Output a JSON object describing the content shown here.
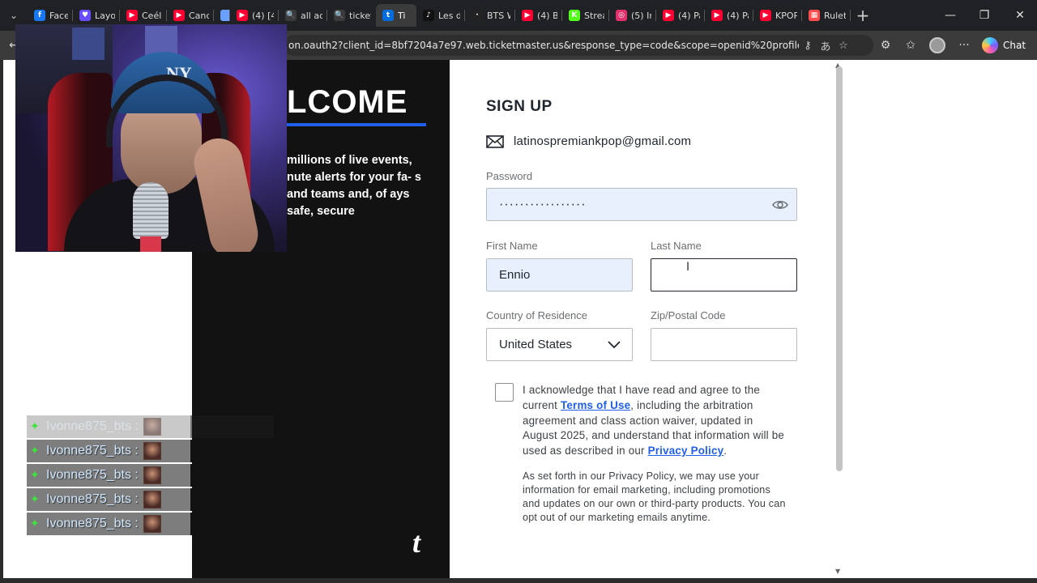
{
  "browser": {
    "tabs": [
      {
        "label": "Faceb",
        "fav_color": "#1877f2",
        "fav_glyph": "f"
      },
      {
        "label": "Layou",
        "fav_color": "#6a4cff",
        "fav_glyph": "♥"
      },
      {
        "label": "Ceéle",
        "fav_color": "#ff0033",
        "fav_glyph": "▶"
      },
      {
        "label": "Canci",
        "fav_color": "#ff0033",
        "fav_glyph": "▶"
      },
      {
        "label": "",
        "fav_color": "#6aa0ff",
        "fav_glyph": ""
      },
      {
        "label": "(4) [4",
        "fav_color": "#ff0033",
        "fav_glyph": "▶"
      },
      {
        "label": "all acc",
        "fav_color": "#3b3b3b",
        "fav_glyph": "🔍"
      },
      {
        "label": "ticket",
        "fav_color": "#3b3b3b",
        "fav_glyph": "🔍"
      },
      {
        "label": "Ti",
        "fav_color": "#026cdf",
        "fav_glyph": "t"
      },
      {
        "label": "Les di",
        "fav_color": "#111111",
        "fav_glyph": "♪"
      },
      {
        "label": "BTS W",
        "fav_color": "#222222",
        "fav_glyph": "·"
      },
      {
        "label": "(4) Bu",
        "fav_color": "#ff0033",
        "fav_glyph": "▶"
      },
      {
        "label": "Strean",
        "fav_color": "#53fc18",
        "fav_glyph": "K"
      },
      {
        "label": "(5) Ins",
        "fav_color": "#e1306c",
        "fav_glyph": "◎"
      },
      {
        "label": "(4) Pa",
        "fav_color": "#ff0033",
        "fav_glyph": "▶"
      },
      {
        "label": "(4) Pa",
        "fav_color": "#ff0033",
        "fav_glyph": "▶"
      },
      {
        "label": "KPOP",
        "fav_color": "#ff0033",
        "fav_glyph": "▶"
      },
      {
        "label": "Rulet",
        "fav_color": "#ff4d4d",
        "fav_glyph": "▦"
      }
    ],
    "active_tab_index": 8,
    "url": "on.oauth2?client_id=8bf7204a7e97.web.ticketmaster.us&response_type=code&scope=openid%20profile%...",
    "chat_label": "Chat"
  },
  "brand_panel": {
    "title": "LCOME",
    "text": "millions of live events, nute alerts for your fa- s and teams and, of ays safe, secure",
    "logo": "t",
    "accent_color": "#1f5ee8"
  },
  "form": {
    "title": "SIGN UP",
    "email": "latinospremiankpop@gmail.com",
    "password_label": "Password",
    "password_value": "·················",
    "first_name_label": "First Name",
    "first_name_value": "Ennio",
    "last_name_label": "Last Name",
    "last_name_value": "",
    "country_label": "Country of Residence",
    "country_value": "United States",
    "zip_label": "Zip/Postal Code",
    "zip_value": "",
    "terms": {
      "part1": "I acknowledge that I have read and agree to the current ",
      "terms_link": "Terms of Use",
      "part2": ", including the arbitration agreement and class action waiver, updated in August 2025, and understand that information will be used as described in our ",
      "privacy_link": "Privacy Policy",
      "part3": "."
    },
    "privacy_note": "As set forth in our Privacy Policy, we may use your information for email marketing, including promotions and updates on our own or third-party products. You can opt out of our marketing emails anytime."
  },
  "stream_overlay": {
    "cap_logo": "NY",
    "chat_messages": [
      {
        "user": "Ivonne875_bts :",
        "faded": true
      },
      {
        "user": "Ivonne875_bts :",
        "faded": false
      },
      {
        "user": "Ivonne875_bts :",
        "faded": false
      },
      {
        "user": "Ivonne875_bts :",
        "faded": false
      },
      {
        "user": "Ivonne875_bts :",
        "faded": false
      }
    ]
  }
}
